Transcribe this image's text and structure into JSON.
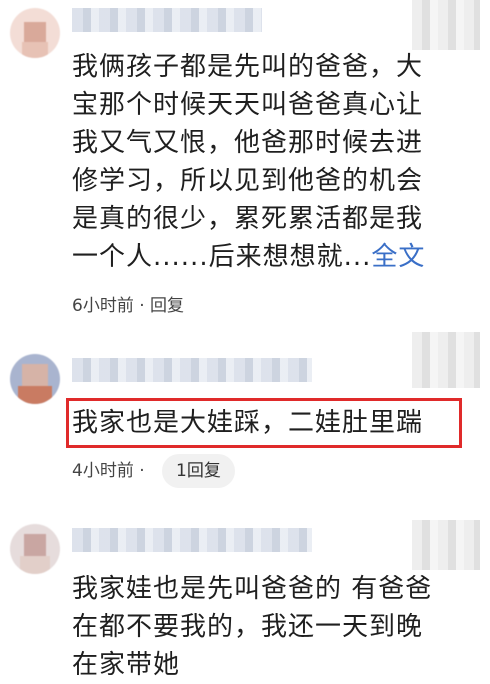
{
  "comments": [
    {
      "text_lines": [
        "我俩孩子都是先叫的爸爸，大",
        "宝那个时候天天叫爸爸真心让",
        "我又气又恨，他爸那时候去进",
        "修学习，所以见到他爸的机会",
        "是真的很少，累死累活都是我",
        "一个人......后来想想就..."
      ],
      "more_label": "全文",
      "time": "6小时前",
      "reply_label": "回复"
    },
    {
      "text": "我家也是大娃踩，二娃肚里踹",
      "time": "4小时前",
      "replies_label": "1回复"
    },
    {
      "text_lines": [
        "我家娃也是先叫爸爸的 有爸爸",
        "在都不要我的，我还一天到晚",
        "在家带她"
      ]
    }
  ],
  "colors": {
    "link": "#3a6fc7",
    "highlight_border": "#e02a2a"
  }
}
